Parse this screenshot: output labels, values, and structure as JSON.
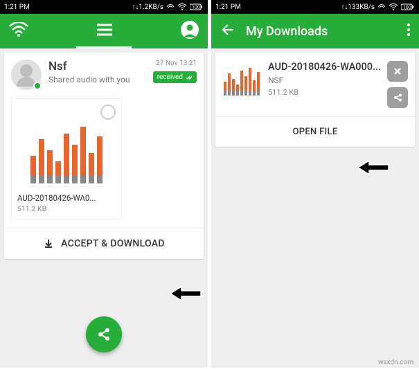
{
  "left": {
    "status": {
      "time": "1:21 PM",
      "speed": "1.2KB/s"
    },
    "sender": "Nsf",
    "subtitle": "Shared audio with you",
    "timestamp": "27 Nov 13:21",
    "badge": "received",
    "file": {
      "name": "AUD-20180426-WA0...",
      "size": "511.2 KB"
    },
    "accept_label": "ACCEPT & DOWNLOAD"
  },
  "right": {
    "status": {
      "time": "1:21 PM",
      "speed": "133KB/s"
    },
    "title": "My Downloads",
    "file": {
      "name": "AUD-20180426-WA000...",
      "sender": "NSF",
      "size": "511.2 KB"
    },
    "open_label": "OPEN FILE"
  },
  "watermark": "wsxdn.com"
}
